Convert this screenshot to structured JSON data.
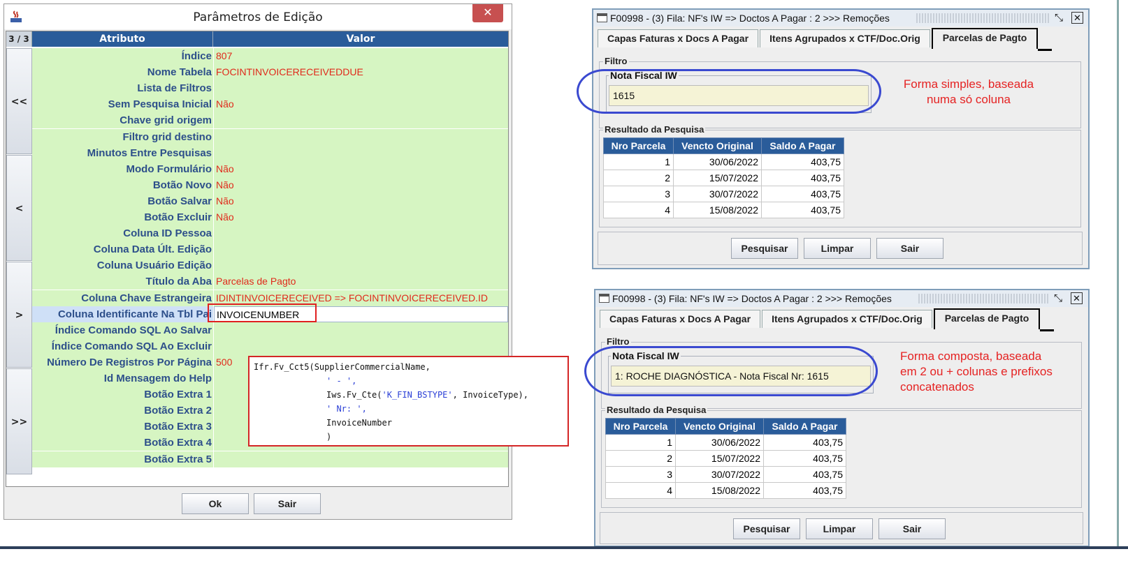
{
  "edit_dialog": {
    "title": "Parâmetros de Edição",
    "close_label": "✕",
    "page_count": "3 / 3",
    "headers": {
      "attribute": "Atributo",
      "value": "Valor"
    },
    "nav": {
      "first": "<<",
      "prev": "<",
      "next": ">",
      "last": ">>"
    },
    "rows": [
      {
        "attr": "Índice",
        "value": "807"
      },
      {
        "attr": "Nome Tabela",
        "value": "FOCINTINVOICERECEIVEDDUE"
      },
      {
        "attr": "Lista de Filtros",
        "value": ""
      },
      {
        "attr": "Sem Pesquisa Inicial",
        "value": "Não"
      },
      {
        "attr": "Chave grid origem",
        "value": ""
      },
      {
        "attr": "Filtro grid destino",
        "value": ""
      },
      {
        "attr": "Minutos Entre Pesquisas",
        "value": ""
      },
      {
        "attr": "Modo Formulário",
        "value": "Não"
      },
      {
        "attr": "Botão Novo",
        "value": "Não"
      },
      {
        "attr": "Botão Salvar",
        "value": "Não"
      },
      {
        "attr": "Botão Excluir",
        "value": "Não"
      },
      {
        "attr": "Coluna ID Pessoa",
        "value": ""
      },
      {
        "attr": "Coluna Data Últ. Edição",
        "value": ""
      },
      {
        "attr": "Coluna Usuário Edição",
        "value": ""
      },
      {
        "attr": "Título da Aba",
        "value": "Parcelas de Pagto"
      },
      {
        "attr": "Coluna Chave Estrangeira",
        "value": "IDINTINVOICERECEIVED => FOCINTINVOICERECEIVED.ID"
      },
      {
        "attr": "Coluna Identificante Na Tbl Pai",
        "value": "INVOICENUMBER"
      },
      {
        "attr": "Índice Comando SQL Ao Salvar",
        "value": ""
      },
      {
        "attr": "Índice Comando SQL Ao Excluir",
        "value": ""
      },
      {
        "attr": "Número De Registros Por Página",
        "value": "500"
      },
      {
        "attr": "Id Mensagem do Help",
        "value": ""
      },
      {
        "attr": "Botão Extra 1",
        "value": ""
      },
      {
        "attr": "Botão Extra 2",
        "value": ""
      },
      {
        "attr": "Botão Extra 3",
        "value": ""
      },
      {
        "attr": "Botão Extra 4",
        "value": ""
      },
      {
        "attr": "Botão Extra 5",
        "value": ""
      }
    ],
    "ok_label": "Ok",
    "exit_label": "Sair",
    "code_lines": [
      "Ifr.Fv_Cct5(SupplierCommercialName,",
      "' - ',",
      "Iws.Fv_Cte('K_FIN_BSTYPE', InvoiceType),",
      "' Nr: ',",
      "InvoiceNumber",
      ")"
    ]
  },
  "windows": [
    {
      "title": "F00998 - (3) Fila: NF's IW => Doctos A Pagar : 2 >>> Remoções",
      "tabs": [
        "Capas Faturas x Docs A Pagar",
        "Itens Agrupados x CTF/Doc.Orig",
        "Parcelas de Pagto"
      ],
      "filter_legend": "Filtro",
      "field_label": "Nota Fiscal IW",
      "field_value": "1615",
      "annotation": [
        "Forma simples, baseada",
        "numa só coluna"
      ],
      "result_legend": "Resultado da Pesquisa",
      "columns": [
        "Nro Parcela",
        "Vencto Original",
        "Saldo A Pagar"
      ],
      "rows": [
        [
          "1",
          "30/06/2022",
          "403,75"
        ],
        [
          "2",
          "15/07/2022",
          "403,75"
        ],
        [
          "3",
          "30/07/2022",
          "403,75"
        ],
        [
          "4",
          "15/08/2022",
          "403,75"
        ]
      ],
      "buttons": [
        "Pesquisar",
        "Limpar",
        "Sair"
      ]
    },
    {
      "title": "F00998 - (3) Fila: NF's IW => Doctos A Pagar : 2 >>> Remoções",
      "tabs": [
        "Capas Faturas x Docs A Pagar",
        "Itens Agrupados x CTF/Doc.Orig",
        "Parcelas de Pagto"
      ],
      "filter_legend": "Filtro",
      "field_label": "Nota Fiscal IW",
      "field_value": "1: ROCHE DIAGNÓSTICA - Nota Fiscal Nr: 1615",
      "annotation": [
        "Forma composta, baseada",
        "em 2 ou + colunas e prefixos",
        "concatenados"
      ],
      "result_legend": "Resultado da Pesquisa",
      "columns": [
        "Nro Parcela",
        "Vencto Original",
        "Saldo A Pagar"
      ],
      "rows": [
        [
          "1",
          "30/06/2022",
          "403,75"
        ],
        [
          "2",
          "15/07/2022",
          "403,75"
        ],
        [
          "3",
          "30/07/2022",
          "403,75"
        ],
        [
          "4",
          "15/08/2022",
          "403,75"
        ]
      ],
      "buttons": [
        "Pesquisar",
        "Limpar",
        "Sair"
      ]
    }
  ],
  "colors": {
    "header_blue": "#2a5c9a",
    "row_green": "#d6f5c2",
    "value_red": "#e02a1b",
    "attr_blue": "#2d4f8a",
    "annotation_red": "#e52222",
    "ellipse_blue": "#3a49d0",
    "input_yellow": "#f5f3d6"
  },
  "icons": {
    "app_icon": "java-app-icon",
    "window_icon": "window-icon",
    "pin_icon": "pin-icon",
    "close_icon": "close-icon"
  }
}
